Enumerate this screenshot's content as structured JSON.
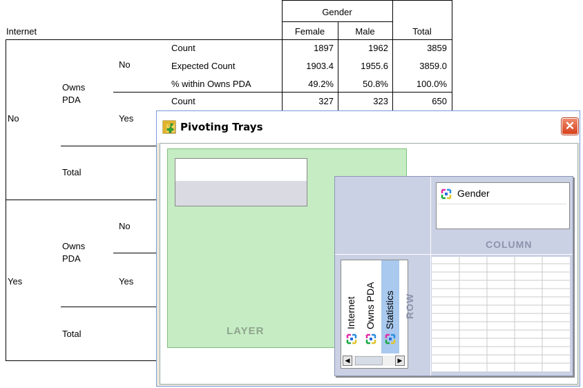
{
  "table": {
    "gender_header": "Gender",
    "col_internet": "Internet",
    "col_female": "Female",
    "col_male": "Male",
    "col_total": "Total",
    "internet_no": "No",
    "internet_yes": "Yes",
    "owns_pda": "Owns\nPDA",
    "owns_no": "No",
    "owns_yes": "Yes",
    "total": "Total",
    "stat_count": "Count",
    "stat_expected": "Expected Count",
    "stat_pct": "% within Owns PDA",
    "rows": [
      {
        "female": "1897",
        "male": "1962",
        "total": "3859"
      },
      {
        "female": "1903.4",
        "male": "1955.6",
        "total": "3859.0"
      },
      {
        "female": "49.2%",
        "male": "50.8%",
        "total": "100.0%"
      },
      {
        "female": "327",
        "male": "323",
        "total": "650"
      }
    ]
  },
  "dialog": {
    "title": "Pivoting Trays",
    "close": "✕",
    "layer_label": "LAYER",
    "column_label": "COLUMN",
    "row_label": "ROW",
    "column_items": [
      "Gender"
    ],
    "row_items": [
      "Internet",
      "Owns PDA",
      "Statistics"
    ],
    "scroll_left": "◀",
    "scroll_right": "▶"
  },
  "colors": {
    "layer_bg": "#c6ecc3",
    "pivot_bg": "#cbd1e4",
    "selected_row_item": "#a9c9ee",
    "close_button": "#d6401b"
  }
}
